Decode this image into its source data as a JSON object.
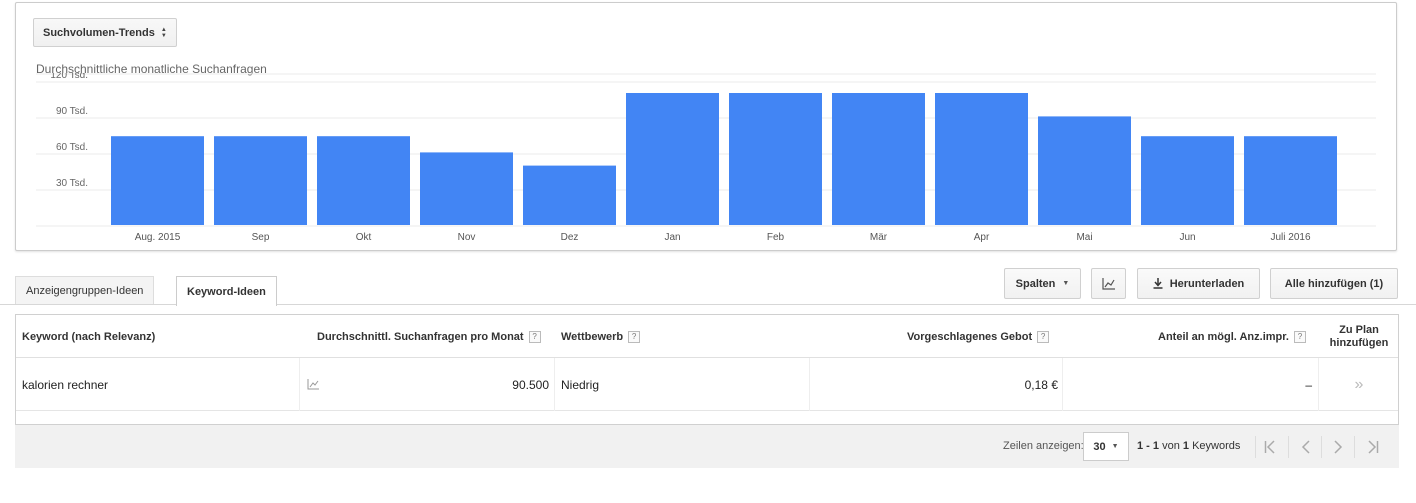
{
  "chart_card": {
    "select_label": "Suchvolumen-Trends",
    "title": "Durchschnittliche monatliche Suchanfragen"
  },
  "chart_data": {
    "type": "bar",
    "title": "Durchschnittliche monatliche Suchanfragen",
    "categories": [
      "Aug. 2015",
      "Sep",
      "Okt",
      "Nov",
      "Dez",
      "Jan",
      "Feb",
      "Mär",
      "Apr",
      "Mai",
      "Jun",
      "Juli 2016"
    ],
    "values": [
      74000,
      74000,
      74000,
      60500,
      49500,
      110000,
      110000,
      110000,
      110000,
      90500,
      74000,
      74000
    ],
    "yticks": [
      30000,
      60000,
      90000,
      120000
    ],
    "ytick_labels": [
      "30 Tsd.",
      "60 Tsd.",
      "90 Tsd.",
      "120 Tsd."
    ],
    "ylim": [
      0,
      120000
    ],
    "grid": true,
    "bar_color": "#4285f4",
    "grid_color": "#ebebeb"
  },
  "tabs": {
    "adgroup_ideas": "Anzeigengruppen-Ideen",
    "keyword_ideas": "Keyword-Ideen"
  },
  "toolbar": {
    "columns": "Spalten",
    "download": "Herunterladen",
    "add_all": "Alle hinzufügen (1)"
  },
  "table": {
    "headers": {
      "keyword": "Keyword (nach Relevanz)",
      "avg_searches": "Durchschnittl. Suchanfragen pro Monat",
      "competition": "Wettbewerb",
      "suggested_bid": "Vorgeschlagenes Gebot",
      "impr_share": "Anteil an mögl. Anz.impr.",
      "add_to_plan_1": "Zu Plan",
      "add_to_plan_2": "hinzufügen",
      "help": "?"
    },
    "rows": [
      {
        "keyword": "kalorien rechner",
        "avg_searches": "90.500",
        "competition": "Niedrig",
        "suggested_bid": "0,18 €",
        "impr_share": "–",
        "add_glyph": "»"
      }
    ]
  },
  "footer": {
    "rows_label": "Zeilen anzeigen:",
    "rows_value": "30",
    "range": "1 - 1",
    "of": "von",
    "total": "1",
    "unit": "Keywords"
  }
}
